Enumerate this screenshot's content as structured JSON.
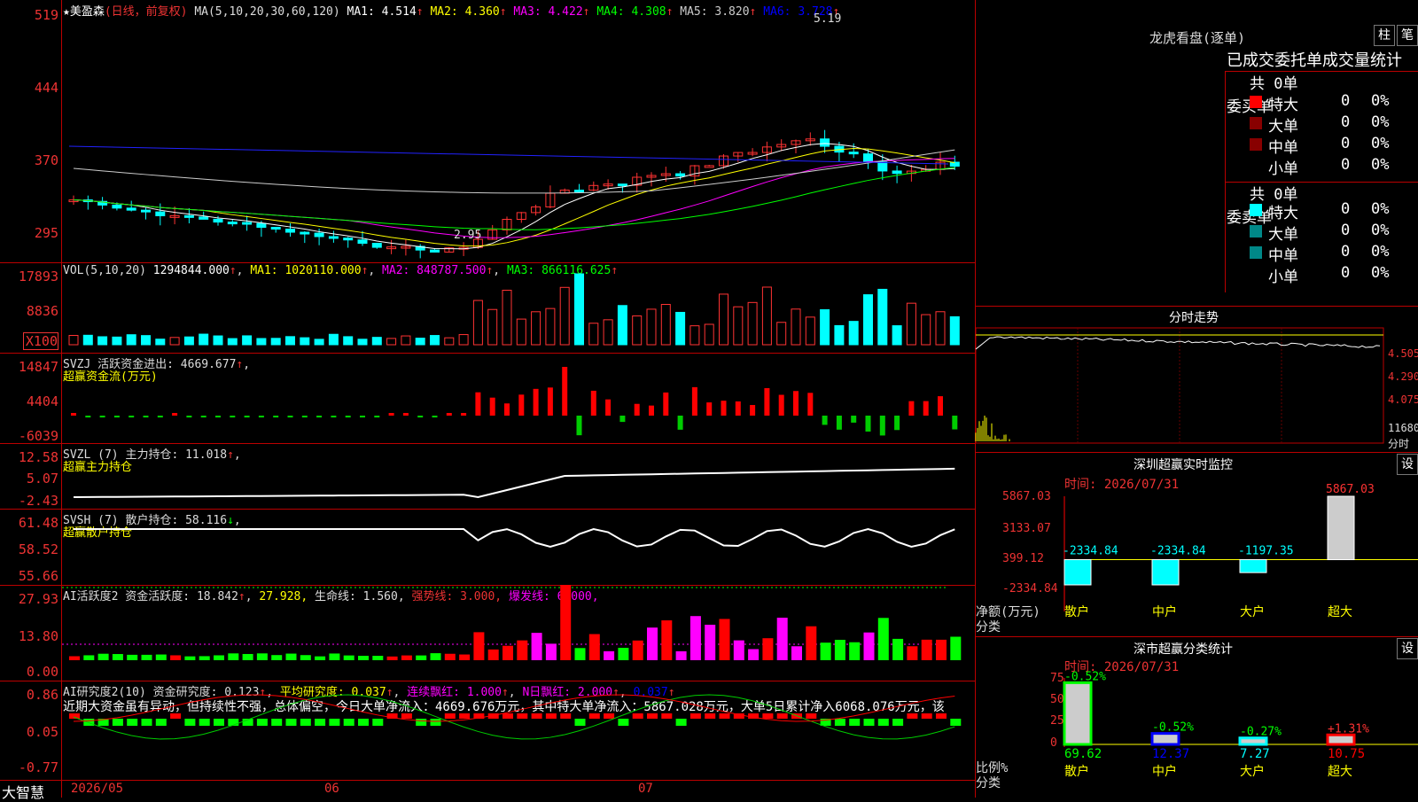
{
  "stock": {
    "name": "★美盈森",
    "period": "(日线，前复权)",
    "ma_def": "MA(5,10,20,30,60,120)",
    "ma": [
      {
        "l": "MA1: 4.514",
        "c": "#fff"
      },
      {
        "l": "MA2: 4.360",
        "c": "#ff0"
      },
      {
        "l": "MA3: 4.422",
        "c": "#f0f"
      },
      {
        "l": "MA4: 4.308",
        "c": "#0f0"
      },
      {
        "l": "MA5: 3.820",
        "c": "#ccc"
      },
      {
        "l": "MA6: 3.728",
        "c": "#00f"
      }
    ],
    "high_mark": "5.19",
    "low_mark": "2.95",
    "yticks": [
      "519",
      "444",
      "370",
      "295"
    ]
  },
  "vol": {
    "label": "VOL(5,10,20)",
    "v": "1294844.000",
    "ma1": "MA1: 1020110.000",
    "ma2": "MA2: 848787.500",
    "ma3": "MA3: 866116.625",
    "yticks": [
      "17893",
      "8836"
    ],
    "unit": "X100"
  },
  "svzj": {
    "label": "SVZJ  活跃资金进出: 4669.677",
    "sub": "超赢资金流(万元)",
    "yticks": [
      "14847",
      "4404",
      "-6039"
    ]
  },
  "svzl": {
    "label": "SVZL  (7) 主力持仓: 11.018",
    "sub": "超赢主力持仓",
    "yticks": [
      "12.58",
      "5.07",
      "-2.43"
    ]
  },
  "svsh": {
    "label": "SVSH  (7) 散户持仓: 58.116",
    "sub": "超赢散户持仓",
    "yticks": [
      "61.48",
      "58.52",
      "55.66"
    ]
  },
  "ai1": {
    "p1": "AI活跃度2 资金活跃度: 18.842",
    "p2": "27.928,",
    "p3": "生命线: 1.560,",
    "p4": "强势线: 3.000,",
    "p5": "爆发线: 6.000,",
    "yticks": [
      "27.93",
      "13.80",
      "0.00"
    ]
  },
  "ai2": {
    "p1": "AI研究度2(10) 资金研究度: 0.123",
    "p2": "平均研究度: 0.037",
    "p3": "连续飘红: 1.000",
    "p4": "N日飘红: 2.000",
    "p5": "0.037",
    "text": "近期大资金虽有异动，但持续性不强，总体偏空，今日大单净流入：4669.676万元，其中特大单净流入：5867.028万元，大单5日累计净入6068.076万元，该",
    "yticks": [
      "0.86",
      "0.05",
      "-0.77"
    ]
  },
  "xaxis": {
    "app": "大智慧",
    "dates": [
      "2026/05",
      "06",
      "07"
    ]
  },
  "rp": {
    "title": "龙虎看盘(逐单)",
    "b1": "柱",
    "b2": "笔",
    "hdr": "已成交委托单成交量统计",
    "buy": "委买单",
    "sell": "委卖单",
    "tot": "共 0单",
    "cats": [
      "特大",
      "大单",
      "中单",
      "小单"
    ],
    "zero": "0",
    "pct": "0%",
    "bcol": [
      "#f00",
      "#800",
      "#800",
      "#000"
    ],
    "scol": [
      "#0ff",
      "#088",
      "#088",
      "#000"
    ]
  },
  "ts": {
    "title": "分时走势",
    "y": [
      "4.505",
      "4.290",
      "4.075",
      "11680"
    ],
    "fs": "分时"
  },
  "sz": {
    "title": "深圳超赢实时监控",
    "set": "设",
    "time": "时间: 2026/07/31",
    "y": [
      "5867.03",
      "3133.07",
      "399.12",
      "-2334.84"
    ],
    "net": "净额(万元)",
    "cls": "分类",
    "cats": [
      "散户",
      "中户",
      "大户",
      "超大"
    ],
    "vals": [
      -2334.84,
      -2334.84,
      -1197.35,
      5867.03
    ],
    "vl": [
      "-2334.84",
      "-2334.84",
      "-1197.35",
      "5867.03"
    ]
  },
  "ss": {
    "title": "深市超赢分类统计",
    "set": "设",
    "time": "时间: 2026/07/31",
    "y": [
      "75",
      "50",
      "25",
      "0"
    ],
    "ratio": "比例%",
    "cls": "分类",
    "cats": [
      "散户",
      "中户",
      "大户",
      "超大"
    ],
    "vals": [
      69.62,
      12.37,
      7.27,
      10.75
    ],
    "chg": [
      "-0.52%",
      "-0.52%",
      "-0.27%",
      "+1.31%"
    ]
  }
}
